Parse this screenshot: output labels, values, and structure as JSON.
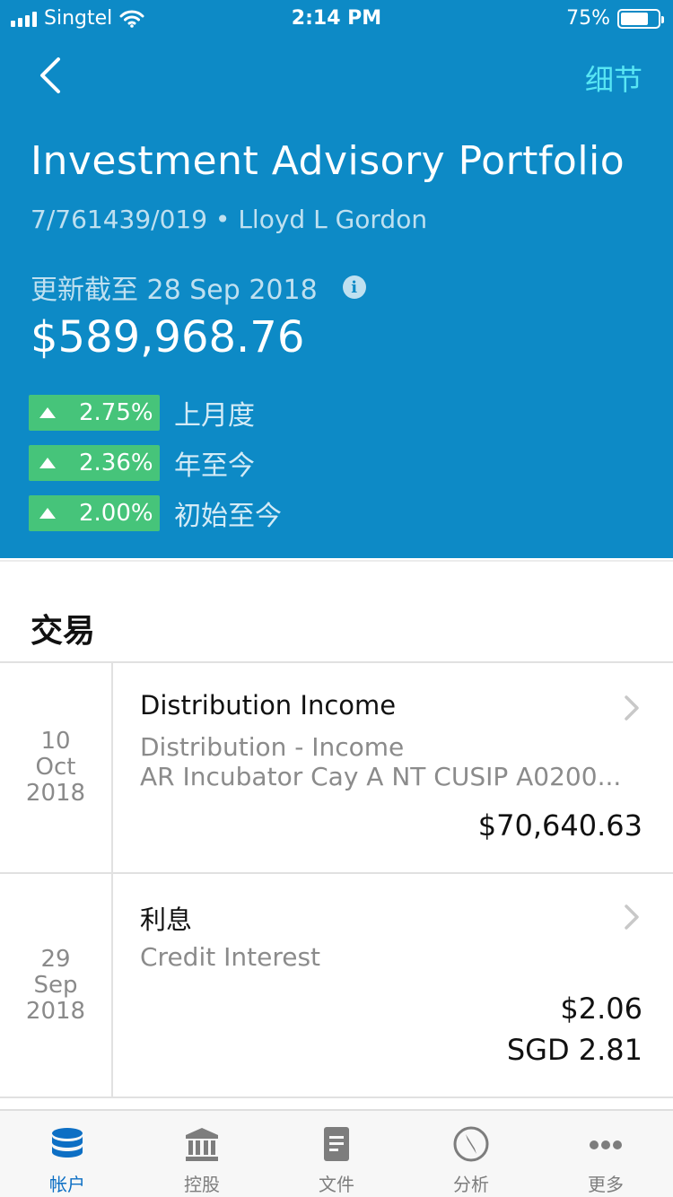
{
  "status_bar": {
    "carrier": "Singtel",
    "time": "2:14 PM",
    "battery_percent": "75%",
    "battery_level": 0.75
  },
  "nav": {
    "detail_label": "细节"
  },
  "account": {
    "title": "Investment Advisory Portfolio",
    "subtitle": "7/761439/019 • Lloyd L Gordon",
    "updated": "更新截至 28 Sep 2018",
    "balance": "$589,968.76"
  },
  "performance": [
    {
      "value": "2.75%",
      "label": "上月度"
    },
    {
      "value": "2.36%",
      "label": "年至今"
    },
    {
      "value": "2.00%",
      "label": "初始至今"
    }
  ],
  "transactions": {
    "section_title": "交易",
    "items": [
      {
        "day": "10",
        "month": "Oct",
        "year": "2018",
        "title": "Distribution Income",
        "line1": "Distribution - Income",
        "line2": "AR Incubator Cay A NT CUSIP A0200...",
        "amount": "$70,640.63",
        "amount2": ""
      },
      {
        "day": "29",
        "month": "Sep",
        "year": "2018",
        "title": "利息",
        "line1": "Credit Interest",
        "line2": "",
        "amount": "$2.06",
        "amount2": "SGD 2.81"
      }
    ]
  },
  "tabbar": {
    "tabs": [
      {
        "label": "帐户",
        "icon": "database-icon",
        "active": true
      },
      {
        "label": "控股",
        "icon": "bank-icon",
        "active": false
      },
      {
        "label": "文件",
        "icon": "document-icon",
        "active": false
      },
      {
        "label": "分析",
        "icon": "compass-icon",
        "active": false
      },
      {
        "label": "更多",
        "icon": "more-icon",
        "active": false
      }
    ]
  },
  "colors": {
    "header_bg": "#0d8ac6",
    "accent_cyan": "#58e6f4",
    "perf_green": "#46c47a",
    "tab_active": "#0d6fc4"
  }
}
